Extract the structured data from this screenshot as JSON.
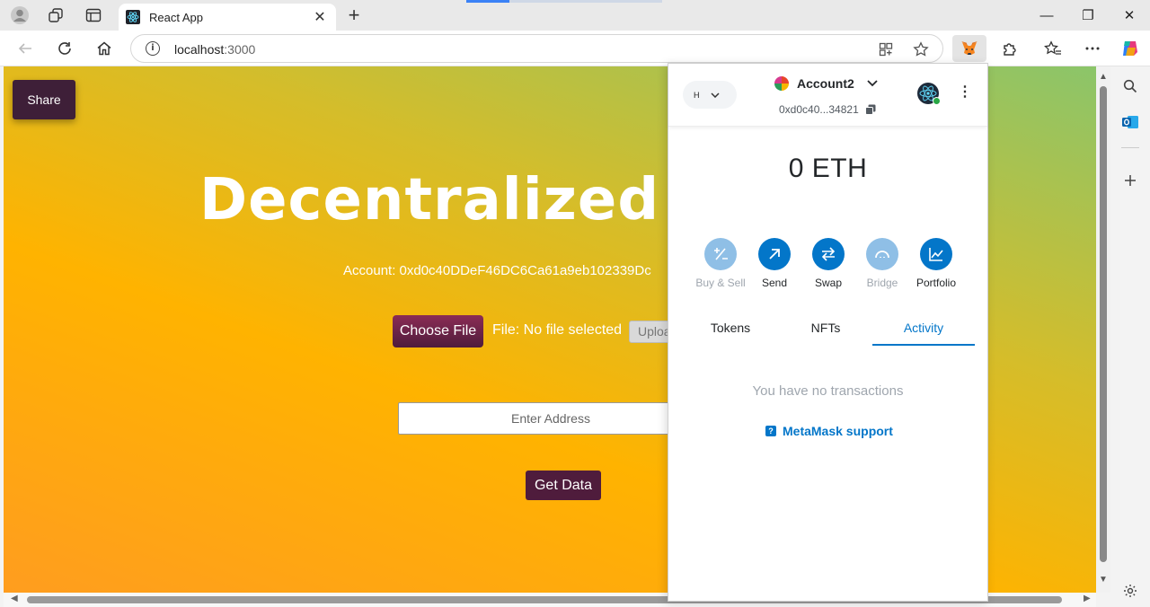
{
  "browser": {
    "tab_title": "React App",
    "new_tab_symbol": "+",
    "url_host": "localhost",
    "url_port": ":3000",
    "minimize_symbol": "—",
    "restore_symbol": "❐",
    "close_symbol": "✕",
    "tab_close_symbol": "✕"
  },
  "page": {
    "share_label": "Share",
    "hero_title": "Decentralized File",
    "account_text": "Account: 0xd0c40DDeF46DC6Ca61a9eb102339Dc",
    "choose_file_label": "Choose File",
    "file_status": "File: No file selected",
    "upload_label": "Uploa",
    "address_placeholder": "Enter Address",
    "get_data_label": "Get Data"
  },
  "metamask": {
    "network_letter": "H",
    "account_name": "Account2",
    "account_address": "0xd0c40...34821",
    "balance": "0 ETH",
    "actions": [
      {
        "label": "Buy & Sell",
        "icon": "buy-sell-icon",
        "enabled": false
      },
      {
        "label": "Send",
        "icon": "send-icon",
        "enabled": true
      },
      {
        "label": "Swap",
        "icon": "swap-icon",
        "enabled": true
      },
      {
        "label": "Bridge",
        "icon": "bridge-icon",
        "enabled": false
      },
      {
        "label": "Portfolio",
        "icon": "portfolio-icon",
        "enabled": true
      }
    ],
    "tabs": [
      {
        "label": "Tokens",
        "active": false
      },
      {
        "label": "NFTs",
        "active": false
      },
      {
        "label": "Activity",
        "active": true
      }
    ],
    "empty_message": "You have no transactions",
    "support_link": "MetaMask support"
  },
  "colors": {
    "metamask_blue": "#0376c9",
    "button_plum": "#4f1c3c",
    "share_button": "#3e1f38"
  }
}
